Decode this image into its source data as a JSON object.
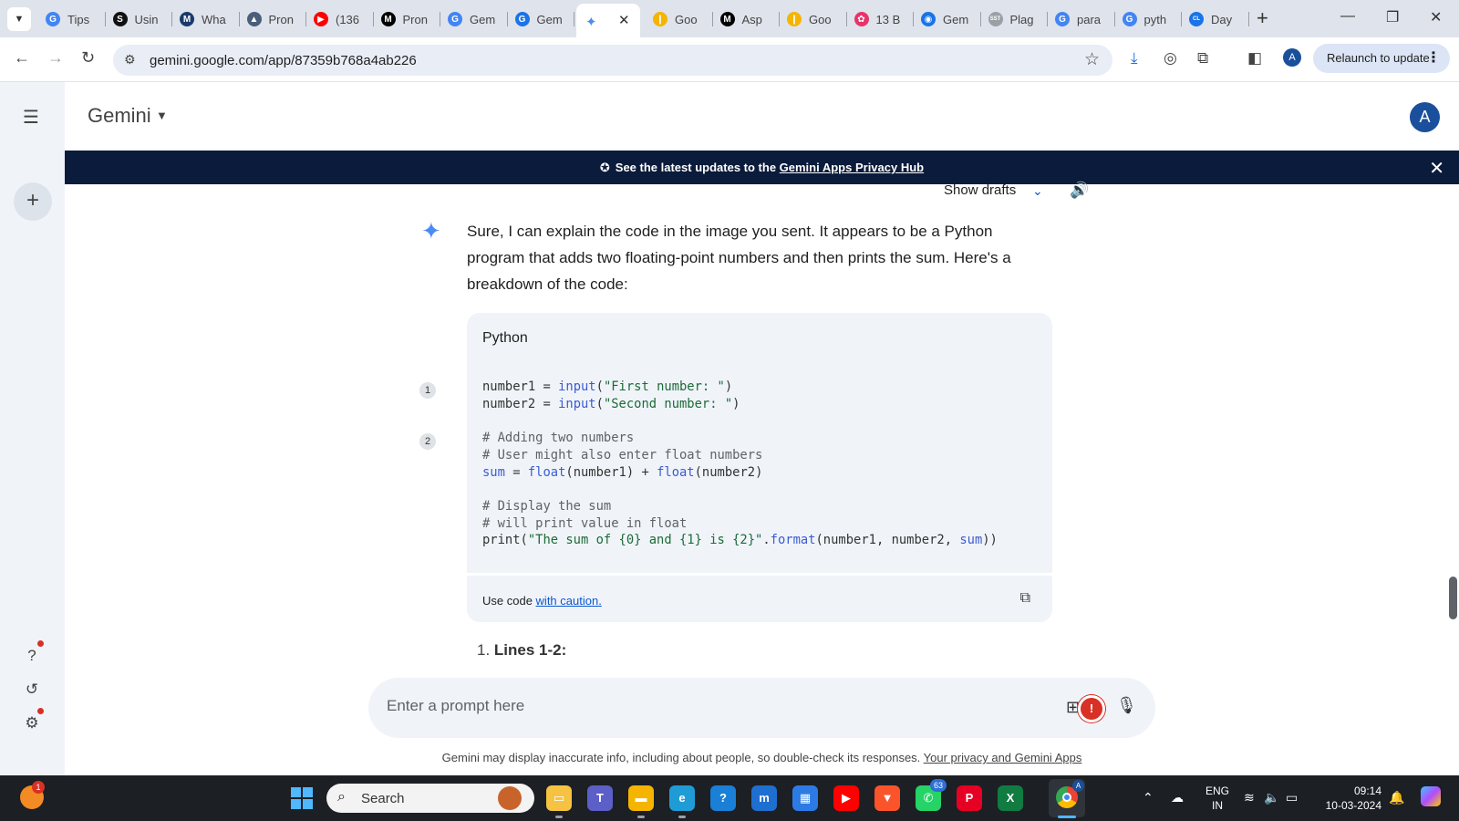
{
  "browser": {
    "tabs": [
      {
        "label": "Tips",
        "icon": "google-icon",
        "color": "#4285f4",
        "glyph": "G"
      },
      {
        "label": "Usin",
        "icon": "s-logo-icon",
        "color": "#111111",
        "glyph": "S"
      },
      {
        "label": "Wha",
        "icon": "m-logo-icon",
        "color": "#1a3a6b",
        "glyph": "M"
      },
      {
        "label": "Pron",
        "icon": "school-icon",
        "color": "#4a5e7a",
        "glyph": "▲"
      },
      {
        "label": "(136",
        "icon": "youtube-icon",
        "color": "#ff0000",
        "glyph": "▶"
      },
      {
        "label": "Pron",
        "icon": "medium-icon",
        "color": "#000000",
        "glyph": "M"
      },
      {
        "label": "Gem",
        "icon": "google-icon",
        "color": "#4285f4",
        "glyph": "G"
      },
      {
        "label": "Gem",
        "icon": "gemini-blue-icon",
        "color": "#1a73e8",
        "glyph": "G"
      }
    ],
    "active_tab": {
      "icon": "gemini-icon",
      "close_glyph": "✕"
    },
    "tabs_after": [
      {
        "label": "Goo",
        "icon": "google-bar-icon",
        "color": "#f4b400",
        "glyph": "❙"
      },
      {
        "label": "Asp",
        "icon": "medium-icon",
        "color": "#000000",
        "glyph": "M"
      },
      {
        "label": "Goo",
        "icon": "google-bar-icon",
        "color": "#f4b400",
        "glyph": "❙"
      },
      {
        "label": "13 B",
        "icon": "flower-icon",
        "color": "#e8336a",
        "glyph": "✿"
      },
      {
        "label": "Gem",
        "icon": "gemini-blue-icon",
        "color": "#1a73e8",
        "glyph": "◉"
      },
      {
        "label": "Plag",
        "icon": "sst-icon",
        "color": "#9aa0a6",
        "glyph": "SST"
      },
      {
        "label": "para",
        "icon": "google-icon",
        "color": "#4285f4",
        "glyph": "G"
      },
      {
        "label": "pyth",
        "icon": "google-icon",
        "color": "#4285f4",
        "glyph": "G"
      },
      {
        "label": "Day",
        "icon": "cl-logo-icon",
        "color": "#1a73e8",
        "glyph": "CL"
      }
    ],
    "url": "gemini.google.com/app/87359b768a4ab226",
    "relaunch_label": "Relaunch to update",
    "profile_initial": "A"
  },
  "header": {
    "app_name": "Gemini",
    "avatar_initial": "A"
  },
  "banner": {
    "text": "See the latest updates to the ",
    "link": "Gemini Apps Privacy Hub"
  },
  "response": {
    "show_drafts": "Show drafts",
    "intro": "Sure, I can explain the code in the image you sent. It appears to be a Python program that adds two floating-point numbers and then prints the sum. Here's a breakdown of the code:",
    "code_language": "Python",
    "citations": [
      "1",
      "2"
    ],
    "code_lines": [
      "number1 = input(\"First number: \")",
      "number2 = input(\"Second number: \")",
      "",
      "# Adding two numbers",
      "# User might also enter float numbers",
      "sum = float(number1) + float(number2)",
      "",
      "# Display the sum",
      "# will print value in float",
      "print(\"The sum of {0} and {1} is {2}\".format(number1, number2, sum))"
    ],
    "caution_prefix": "Use code ",
    "caution_link": "with caution.",
    "list_number": "1.",
    "list_title": "Lines 1-2:"
  },
  "prompt": {
    "placeholder": "Enter a prompt here",
    "extension_badge": "!"
  },
  "footer": {
    "disclaimer": "Gemini may display inaccurate info, including about people, so double-check its responses. ",
    "disclaimer_link": "Your privacy and Gemini Apps"
  },
  "taskbar": {
    "search_label": "Search",
    "weather_badge": "1",
    "whatsapp_badge": "63",
    "chrome_badge": "A",
    "language": "ENG",
    "region": "IN",
    "time": "09:14",
    "date": "10-03-2024",
    "apps": [
      {
        "name": "file-explorer-icon",
        "color": "#f5c242",
        "glyph": "▭"
      },
      {
        "name": "teams-icon",
        "color": "#5b5fc7",
        "glyph": "T"
      },
      {
        "name": "folder-icon",
        "color": "#f4b400",
        "glyph": "▬"
      },
      {
        "name": "edge-icon",
        "color": "#1f9cd6",
        "glyph": "e"
      },
      {
        "name": "help-icon",
        "color": "#1a7fd6",
        "glyph": "?"
      },
      {
        "name": "mylp-icon",
        "color": "#1f6fd0",
        "glyph": "m"
      },
      {
        "name": "store-icon",
        "color": "#2c7be5",
        "glyph": "▦"
      },
      {
        "name": "youtube-icon",
        "color": "#ff0000",
        "glyph": "▶"
      },
      {
        "name": "brave-icon",
        "color": "#fb542b",
        "glyph": "▼"
      },
      {
        "name": "whatsapp-icon",
        "color": "#25d366",
        "glyph": "✆"
      },
      {
        "name": "pinterest-icon",
        "color": "#e60023",
        "glyph": "P"
      },
      {
        "name": "excel-icon",
        "color": "#107c41",
        "glyph": "X"
      }
    ]
  }
}
